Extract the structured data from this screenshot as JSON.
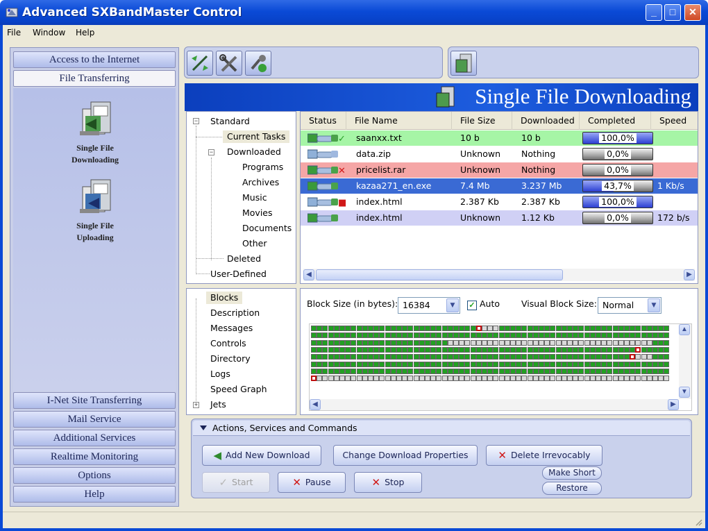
{
  "window": {
    "title": "Advanced SXBandMaster Control"
  },
  "menu": [
    "File",
    "Window",
    "Help"
  ],
  "sidebar": {
    "top_items": [
      "Access to the Internet",
      "File Transferring"
    ],
    "tools": [
      {
        "label_line1": "Single File",
        "label_line2": "Downloading",
        "icon": "download-icon"
      },
      {
        "label_line1": "Single File",
        "label_line2": "Uploading",
        "icon": "upload-icon"
      }
    ],
    "bottom_items": [
      "I-Net Site Transferring",
      "Mail Service",
      "Additional Services",
      "Realtime Monitoring",
      "Options",
      "Help"
    ]
  },
  "toolbar": {
    "icons": [
      "connect-icon",
      "tools-icon",
      "settings-icon"
    ],
    "right_icon": "download-icon"
  },
  "header": {
    "title": "Single File Downloading"
  },
  "tree": {
    "root": "Standard",
    "current_tasks": "Current Tasks",
    "downloaded": "Downloaded",
    "downloaded_children": [
      "Programs",
      "Archives",
      "Music",
      "Movies",
      "Documents",
      "Other"
    ],
    "deleted": "Deleted",
    "user_defined": "User-Defined"
  },
  "tasks": {
    "columns": [
      "Status",
      "File Name",
      "File Size",
      "Downloaded",
      "Completed",
      "Speed"
    ],
    "rows": [
      {
        "name": "saanxx.txt",
        "size": "10 b",
        "downloaded": "10 b",
        "completed": "100,0%",
        "progress": 1.0,
        "speed": "",
        "bg": "#a6f5a6",
        "status": "done"
      },
      {
        "name": "data.zip",
        "size": "Unknown",
        "downloaded": "Nothing",
        "completed": "0,0%",
        "progress": 0.0,
        "speed": "",
        "bg": "#ffffff",
        "status": "queued"
      },
      {
        "name": "pricelist.rar",
        "size": "Unknown",
        "downloaded": "Nothing",
        "completed": "0,0%",
        "progress": 0.0,
        "speed": "",
        "bg": "#f5a6a6",
        "status": "error"
      },
      {
        "name": "kazaa271_en.exe",
        "size": "7.4 Mb",
        "downloaded": "3.237 Mb",
        "completed": "43,7%",
        "progress": 0.437,
        "speed": "1 Kb/s",
        "bg": "#3a6ad4",
        "status": "active"
      },
      {
        "name": "index.html",
        "size": "2.387 Kb",
        "downloaded": "2.387 Kb",
        "completed": "100,0%",
        "progress": 1.0,
        "speed": "",
        "bg": "#ffffff",
        "status": "stopped"
      },
      {
        "name": "index.html",
        "size": "Unknown",
        "downloaded": "1.12 Kb",
        "completed": "0,0%",
        "progress": 0.0,
        "speed": "172 b/s",
        "bg": "#d0d0f5",
        "status": "active"
      }
    ]
  },
  "info_tree": [
    "Blocks",
    "Description",
    "Messages",
    "Controls",
    "Directory",
    "Logs",
    "Speed Graph",
    "Jets"
  ],
  "blocks": {
    "block_size_label": "Block Size (in bytes):",
    "block_size_value": "16384",
    "auto_label": "Auto",
    "auto_checked": true,
    "visual_label": "Visual Block Size:",
    "visual_value": "Normal"
  },
  "actions": {
    "title": "Actions, Services and Commands",
    "add": "Add New Download",
    "change": "Change Download Properties",
    "delete": "Delete Irrevocably",
    "start": "Start",
    "pause": "Pause",
    "stop": "Stop",
    "make_short": "Make Short",
    "restore": "Restore"
  },
  "colors": {
    "accent": "#0b3fbd",
    "panel": "#c9d1ec",
    "selected_row": "#3a6ad4",
    "block_done": "#22a022",
    "block_empty": "#d9d9d9"
  }
}
